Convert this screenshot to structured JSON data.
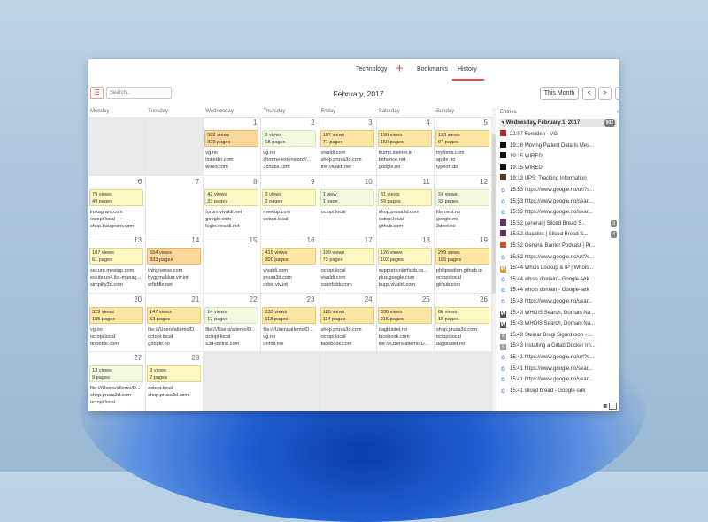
{
  "tabs": [
    {
      "label": "Technology"
    },
    {
      "label": "Bookmarks"
    },
    {
      "label": "History"
    }
  ],
  "toolbar": {
    "search_placeholder": "Search...",
    "month": "February, 2017",
    "this_month": "This Month",
    "prev": "<",
    "next": ">"
  },
  "day_names": [
    "Monday",
    "Tuesday",
    "Wednesday",
    "Thursday",
    "Friday",
    "Saturday",
    "Sunday"
  ],
  "weeks": [
    [
      {
        "empty": true
      },
      {
        "empty": true
      },
      {
        "day": "1",
        "views": "502 views",
        "pages": "329 pages",
        "color": "orange",
        "sites": [
          "vg.no",
          "linkedin.com",
          "wired.com"
        ]
      },
      {
        "day": "2",
        "views": "3 views",
        "pages": "18 pages",
        "color": "light",
        "sites": [
          "vg.no",
          "chrome-extension://...",
          "3chubs.com"
        ]
      },
      {
        "day": "3",
        "views": "107 views",
        "pages": "71 pages",
        "color": "gold",
        "sites": [
          "vivaldi.com",
          "shop.prusa3d.com",
          "the.vivaldi.net"
        ]
      },
      {
        "day": "4",
        "views": "196 views",
        "pages": "150 pages",
        "color": "gold",
        "sites": [
          "trump.steiner.io",
          "behance.net",
          "google.no"
        ]
      },
      {
        "day": "5",
        "views": "133 views",
        "pages": "97 pages",
        "color": "gold",
        "sites": [
          "myfonts.com",
          "apple.no",
          "typeoff.de"
        ]
      }
    ],
    [
      {
        "day": "6",
        "views": "79 views",
        "pages": "49 pages",
        "color": "yellow",
        "sites": [
          "instagram.com",
          "octopi.local",
          "shop.baugeam.com"
        ]
      },
      {
        "day": "7",
        "empty_content": true
      },
      {
        "day": "8",
        "views": "42 views",
        "pages": "33 pages",
        "color": "yellow",
        "sites": [
          "forum.vivaldi.net",
          "google.com",
          "login.vivaldi.net"
        ]
      },
      {
        "day": "9",
        "views": "3 views",
        "pages": "2 pages",
        "color": "yellow",
        "sites": [
          "meetup.com",
          "octopi.local"
        ]
      },
      {
        "day": "10",
        "views": "1 view",
        "pages": "1 page",
        "color": "light",
        "sites": [
          "octopi.local"
        ]
      },
      {
        "day": "11",
        "views": "81 views",
        "pages": "59 pages",
        "color": "yellow",
        "sites": [
          "shop.prusa3d.com",
          "octopi.local",
          "github.com"
        ]
      },
      {
        "day": "12",
        "views": "24 views",
        "pages": "23 pages",
        "color": "light",
        "sites": [
          "filament.no",
          "google.no",
          "3dnet.no"
        ]
      }
    ],
    [
      {
        "day": "13",
        "views": "107 views",
        "pages": "61 pages",
        "color": "yellow",
        "sites": [
          "secure.meetup.com",
          "eskite.us4.list-manag...",
          "simplify3d.com"
        ]
      },
      {
        "day": "14",
        "views": "554 views",
        "pages": "333 pages",
        "color": "orange",
        "sites": [
          "thingiverse.com",
          "byggmakker.viv.int",
          "erfiddle.net"
        ]
      },
      {
        "day": "15",
        "empty_content": true
      },
      {
        "day": "16",
        "views": "419 views",
        "pages": "300 pages",
        "color": "gold",
        "sites": [
          "vivaldi.com",
          "prusa3d.com",
          "orbic.viv.int"
        ]
      },
      {
        "day": "17",
        "views": "100 views",
        "pages": "73 pages",
        "color": "yellow",
        "sites": [
          "octopi.local",
          "vivaldi.com",
          "colorfabb.com"
        ]
      },
      {
        "day": "18",
        "views": "126 views",
        "pages": "102 pages",
        "color": "yellow",
        "sites": [
          "support.colorfabb.co...",
          "plus.google.com",
          "bugs.vivaldi.com"
        ]
      },
      {
        "day": "19",
        "views": "299 views",
        "pages": "165 pages",
        "color": "gold",
        "sites": [
          "philipwelton.github.io",
          "octopi.local",
          "github.com"
        ]
      }
    ],
    [
      {
        "day": "20",
        "views": "329 views",
        "pages": "105 pages",
        "color": "gold",
        "sites": [
          "vg.no",
          "octopi.local",
          "dribbble.com"
        ]
      },
      {
        "day": "21",
        "views": "147 views",
        "pages": "53 pages",
        "color": "gold",
        "sites": [
          "file:///Users/atlemo/D...",
          "octopi.local",
          "google.no"
        ]
      },
      {
        "day": "22",
        "views": "14 views",
        "pages": "12 pages",
        "color": "light",
        "sites": [
          "file:///Users/atlemo/D...",
          "octopi.local",
          "s3d-online.com"
        ]
      },
      {
        "day": "23",
        "views": "333 views",
        "pages": "118 pages",
        "color": "gold",
        "sites": [
          "file:///Users/atlemo/D...",
          "vg.no",
          "unroll.me"
        ]
      },
      {
        "day": "24",
        "views": "185 views",
        "pages": "114 pages",
        "color": "gold",
        "sites": [
          "shop.prusa3d.com",
          "octopi.local",
          "facebook.com"
        ]
      },
      {
        "day": "25",
        "views": "336 views",
        "pages": "215 pages",
        "color": "gold",
        "sites": [
          "dagbladet.no",
          "facebook.com",
          "file:///Users/atlemo/D..."
        ]
      },
      {
        "day": "26",
        "views": "66 views",
        "pages": "10 pages",
        "color": "yellow",
        "sites": [
          "shop.prusa3d.com",
          "octopi.local",
          "dagbladet.no"
        ]
      }
    ],
    [
      {
        "day": "27",
        "views": "13 views",
        "pages": "9 pages",
        "color": "light",
        "sites": [
          "file:///Users/atlemo/D...",
          "shop.prusa3d.com",
          "octopi.local"
        ]
      },
      {
        "day": "28",
        "views": "3 views",
        "pages": "2 pages",
        "color": "yellow",
        "sites": [
          "octopi.local",
          "shop.prusa3d.com"
        ]
      },
      {
        "empty": true
      },
      {
        "empty": true
      },
      {
        "empty": true
      },
      {
        "empty": true
      },
      {
        "empty": true
      }
    ]
  ],
  "entries": {
    "header": "Entries",
    "date": "Wednesday, February 1, 2017",
    "count": "902",
    "items": [
      {
        "time": "22:07",
        "title": "Forsiden - VG",
        "icon": "vg",
        "color": "#c81e1e",
        "glyph": "▪"
      },
      {
        "time": "19:16",
        "title": "Moving Patient Data Is Mes...",
        "icon": "wired",
        "color": "#111",
        "glyph": "▪"
      },
      {
        "time": "19:15",
        "title": "WIRED",
        "icon": "wired",
        "color": "#111",
        "glyph": "▪"
      },
      {
        "time": "19:15",
        "title": "WIRED",
        "icon": "wired",
        "color": "#111",
        "glyph": "▪"
      },
      {
        "time": "19:13",
        "title": "UPS: Tracking Information",
        "icon": "ups",
        "color": "#5a3a1c",
        "glyph": "▪"
      },
      {
        "time": "15:53",
        "title": "https://www.google.no/url?s...",
        "icon": "google",
        "color": "#4a8af4",
        "glyph": "G"
      },
      {
        "time": "15:53",
        "title": "https://www.google.no/sear...",
        "icon": "google",
        "color": "#4a8af4",
        "glyph": "G"
      },
      {
        "time": "15:53",
        "title": "https://www.google.no/sear...",
        "icon": "google",
        "color": "#4a8af4",
        "glyph": "G"
      },
      {
        "time": "15:52",
        "title": "general | Sliced Bread S...",
        "icon": "slack",
        "color": "#6b2a6b",
        "glyph": "▪",
        "badge": "3"
      },
      {
        "time": "15:52",
        "title": "slackbot | Sliced Bread S...",
        "icon": "slack",
        "color": "#6b2a6b",
        "glyph": "▪",
        "badge": "4"
      },
      {
        "time": "15:52",
        "title": "General Banter Podcast | Pr...",
        "icon": "podcast",
        "color": "#d0531f",
        "glyph": "▪"
      },
      {
        "time": "15:52",
        "title": "https://www.google.no/url?s...",
        "icon": "google",
        "color": "#4a8af4",
        "glyph": "G"
      },
      {
        "time": "15:44",
        "title": "Whois Lookup & IP | Whois...",
        "icon": "whois",
        "color": "#e0a020",
        "glyph": "W"
      },
      {
        "time": "15:44",
        "title": "whois domain - Google-søk",
        "icon": "google",
        "color": "#4a8af4",
        "glyph": "G"
      },
      {
        "time": "15:44",
        "title": "whois domain - Google-søk",
        "icon": "google",
        "color": "#4a8af4",
        "glyph": "G"
      },
      {
        "time": "15:43",
        "title": "https://www.google.no/sear...",
        "icon": "google",
        "color": "#4a8af4",
        "glyph": "G"
      },
      {
        "time": "15:43",
        "title": "WHOIS Search, Domain Na...",
        "icon": "whois2",
        "color": "#555",
        "glyph": "W"
      },
      {
        "time": "15:43",
        "title": "WHOIS Search, Domain Na...",
        "icon": "whois2",
        "color": "#555",
        "glyph": "W"
      },
      {
        "time": "15:43",
        "title": "Steinar Bragi Sigurdsson - ...",
        "icon": "doc",
        "color": "#999",
        "glyph": "≡"
      },
      {
        "time": "15:43",
        "title": "Installing a Gitlab Docker Im...",
        "icon": "doc",
        "color": "#999",
        "glyph": "≡"
      },
      {
        "time": "15:41",
        "title": "https://www.google.no/url?s...",
        "icon": "google",
        "color": "#4a8af4",
        "glyph": "G"
      },
      {
        "time": "15:41",
        "title": "https://www.google.no/sear...",
        "icon": "google",
        "color": "#4a8af4",
        "glyph": "G"
      },
      {
        "time": "15:41",
        "title": "https://www.google.no/sear...",
        "icon": "google",
        "color": "#4a8af4",
        "glyph": "G"
      },
      {
        "time": "15:41",
        "title": "sliced bread - Google-søk",
        "icon": "google",
        "color": "#4a8af4",
        "glyph": "G"
      }
    ]
  }
}
